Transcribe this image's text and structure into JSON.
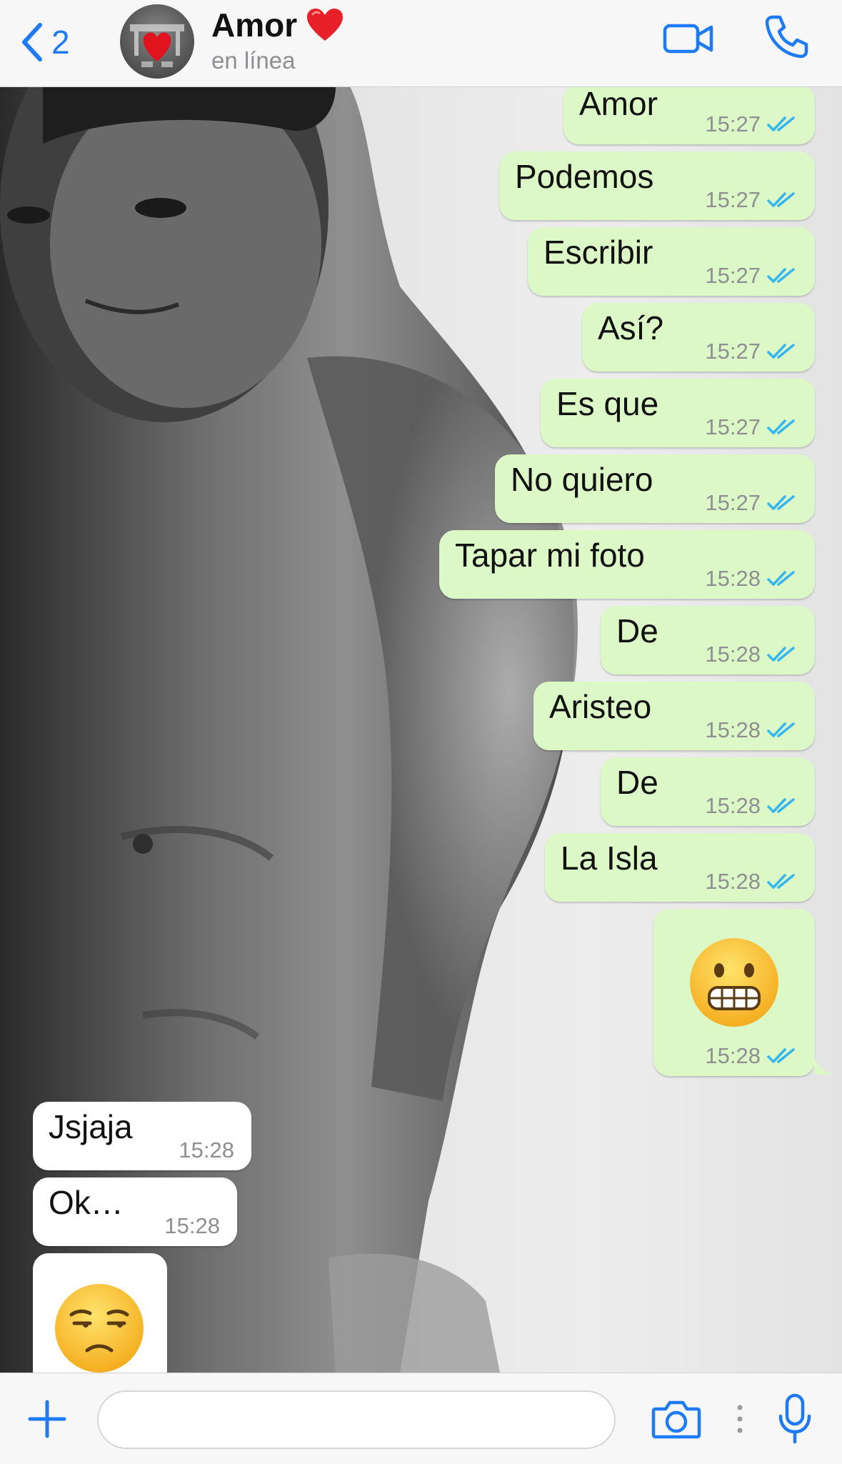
{
  "header": {
    "back_count": "2",
    "contact_name": "Amor",
    "status": "en línea"
  },
  "messages": [
    {
      "direction": "out",
      "text": "Amor",
      "time": "15:27"
    },
    {
      "direction": "out",
      "text": "Podemos",
      "time": "15:27"
    },
    {
      "direction": "out",
      "text": "Escribir",
      "time": "15:27"
    },
    {
      "direction": "out",
      "text": "Así?",
      "time": "15:27"
    },
    {
      "direction": "out",
      "text": "Es que",
      "time": "15:27"
    },
    {
      "direction": "out",
      "text": "No quiero",
      "time": "15:27"
    },
    {
      "direction": "out",
      "text": "Tapar mi foto",
      "time": "15:28"
    },
    {
      "direction": "out",
      "text": "De",
      "time": "15:28"
    },
    {
      "direction": "out",
      "text": "Aristeo",
      "time": "15:28"
    },
    {
      "direction": "out",
      "text": "De",
      "time": "15:28"
    },
    {
      "direction": "out",
      "text": "La Isla",
      "time": "15:28"
    },
    {
      "direction": "out",
      "emoji": "grimacing-face",
      "time": "15:28"
    },
    {
      "direction": "in",
      "text": "Jsjaja",
      "time": "15:28"
    },
    {
      "direction": "in",
      "text": "Ok…",
      "time": "15:28"
    },
    {
      "direction": "in",
      "emoji": "unamused-face"
    }
  ],
  "composer": {
    "placeholder": ""
  },
  "icons": {
    "back": "chevron-left-icon",
    "video": "video-camera-icon",
    "call": "phone-icon",
    "attach": "plus-icon",
    "camera": "camera-icon",
    "mic": "microphone-icon",
    "read_receipt": "double-check-icon"
  },
  "colors": {
    "accent": "#1f7bf5",
    "outgoing_bubble": "#dcf8c6",
    "incoming_bubble": "#ffffff",
    "read_ticks": "#34b7f1",
    "time_text": "#8e8e93"
  }
}
